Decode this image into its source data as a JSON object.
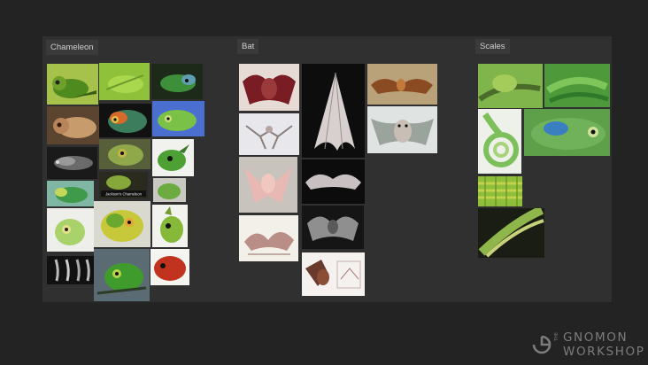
{
  "groups": [
    {
      "label": "Chameleon"
    },
    {
      "label": "Bat"
    },
    {
      "label": "Scales"
    }
  ],
  "chameleon_caption": "Jackson's Chameleon",
  "watermark": {
    "the": "THE",
    "line1": "GNOMON",
    "line2": "WORKSHOP"
  },
  "colors": {
    "page_bg": "#232323",
    "board_bg": "#303030",
    "label_bg": "#3a3a3a",
    "watermark": "#7c7c7c"
  }
}
